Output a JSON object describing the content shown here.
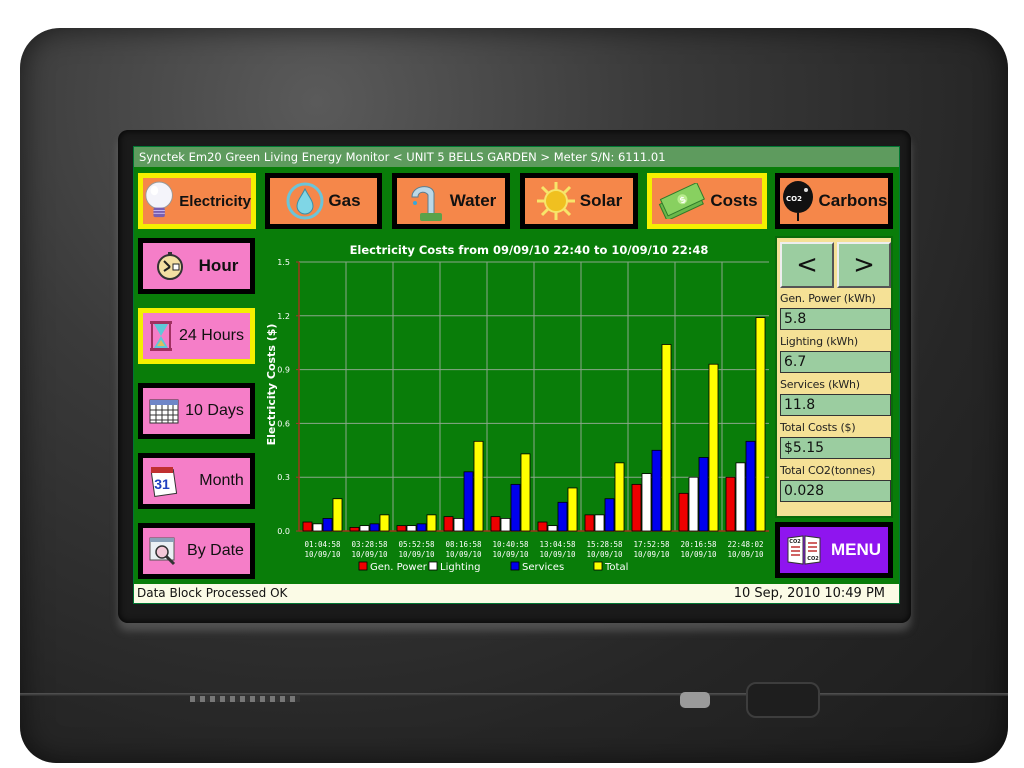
{
  "window": {
    "title": "Synctek Em20 Green Living Energy Monitor < UNIT 5 BELLS GARDEN > Meter S/N: 6111.01"
  },
  "top_tabs": [
    {
      "label": "Electricity",
      "icon": "light-bulb-icon",
      "selected": true
    },
    {
      "label": "Gas",
      "icon": "gas-drop-icon",
      "selected": false
    },
    {
      "label": "Water",
      "icon": "water-tap-icon",
      "selected": false
    },
    {
      "label": "Solar",
      "icon": "sun-icon",
      "selected": false
    },
    {
      "label": "Costs",
      "icon": "money-icon",
      "selected": true
    },
    {
      "label": "Carbons",
      "icon": "co2-balloon-icon",
      "selected": false
    }
  ],
  "period_buttons": [
    {
      "label": "Hour",
      "icon": "stopwatch-icon",
      "selected": false
    },
    {
      "label": "24 Hours",
      "icon": "hourglass-icon",
      "selected": true
    },
    {
      "label": "10 Days",
      "icon": "calendar-icon",
      "selected": false
    },
    {
      "label": "Month",
      "icon": "tear-off-calendar-icon",
      "selected": false
    },
    {
      "label": "By Date",
      "icon": "calendar-search-icon",
      "selected": false
    }
  ],
  "nav": {
    "prev_label": "<",
    "next_label": ">"
  },
  "readings": [
    {
      "label": "Gen. Power (kWh)",
      "value": "5.8"
    },
    {
      "label": "Lighting (kWh)",
      "value": "6.7"
    },
    {
      "label": "Services (kWh)",
      "value": "11.8"
    },
    {
      "label": "Total Costs ($)",
      "value": "$5.15"
    },
    {
      "label": "Total CO2(tonnes)",
      "value": "0.028"
    }
  ],
  "menu": {
    "label": "MENU",
    "icon": "co2-book-icon"
  },
  "status": {
    "message": "Data Block Processed OK",
    "datetime": "10 Sep, 2010 10:49 PM"
  },
  "colors": {
    "screen_bg": "#097d09",
    "tab_orange": "#f5874a",
    "period_pink": "#f57ec8",
    "selected_border": "#f4f000",
    "menu_purple": "#8f15ef",
    "panel_yellow": "#f5e196",
    "field_green": "#9bcda0"
  },
  "chart_data": {
    "type": "bar",
    "title": "Electricity Costs from 09/09/10 22:40 to 10/09/10 22:48",
    "xlabel": "",
    "ylabel": "Electricity Costs ($)",
    "ylim": [
      0,
      1.5
    ],
    "yticks": [
      "0.0",
      "0.3",
      "0.6",
      "0.9",
      "1.2",
      "1.5"
    ],
    "grid": true,
    "legend_position": "bottom",
    "categories": [
      [
        "01:04:58",
        "10/09/10"
      ],
      [
        "03:28:58",
        "10/09/10"
      ],
      [
        "05:52:58",
        "10/09/10"
      ],
      [
        "08:16:58",
        "10/09/10"
      ],
      [
        "10:40:58",
        "10/09/10"
      ],
      [
        "13:04:58",
        "10/09/10"
      ],
      [
        "15:28:58",
        "10/09/10"
      ],
      [
        "17:52:58",
        "10/09/10"
      ],
      [
        "20:16:58",
        "10/09/10"
      ],
      [
        "22:48:02",
        "10/09/10"
      ]
    ],
    "series": [
      {
        "name": "Gen. Power",
        "color": "#ee0000",
        "values": [
          0.05,
          0.02,
          0.03,
          0.08,
          0.08,
          0.05,
          0.09,
          0.26,
          0.21,
          0.3
        ]
      },
      {
        "name": "Lighting",
        "color": "#ffffff",
        "values": [
          0.04,
          0.03,
          0.03,
          0.07,
          0.07,
          0.03,
          0.09,
          0.32,
          0.3,
          0.38
        ]
      },
      {
        "name": "Services",
        "color": "#0000ee",
        "values": [
          0.07,
          0.04,
          0.04,
          0.33,
          0.26,
          0.16,
          0.18,
          0.45,
          0.41,
          0.5
        ]
      },
      {
        "name": "Total",
        "color": "#ffff00",
        "values": [
          0.18,
          0.09,
          0.09,
          0.5,
          0.43,
          0.24,
          0.38,
          1.04,
          0.93,
          1.19
        ]
      }
    ]
  }
}
